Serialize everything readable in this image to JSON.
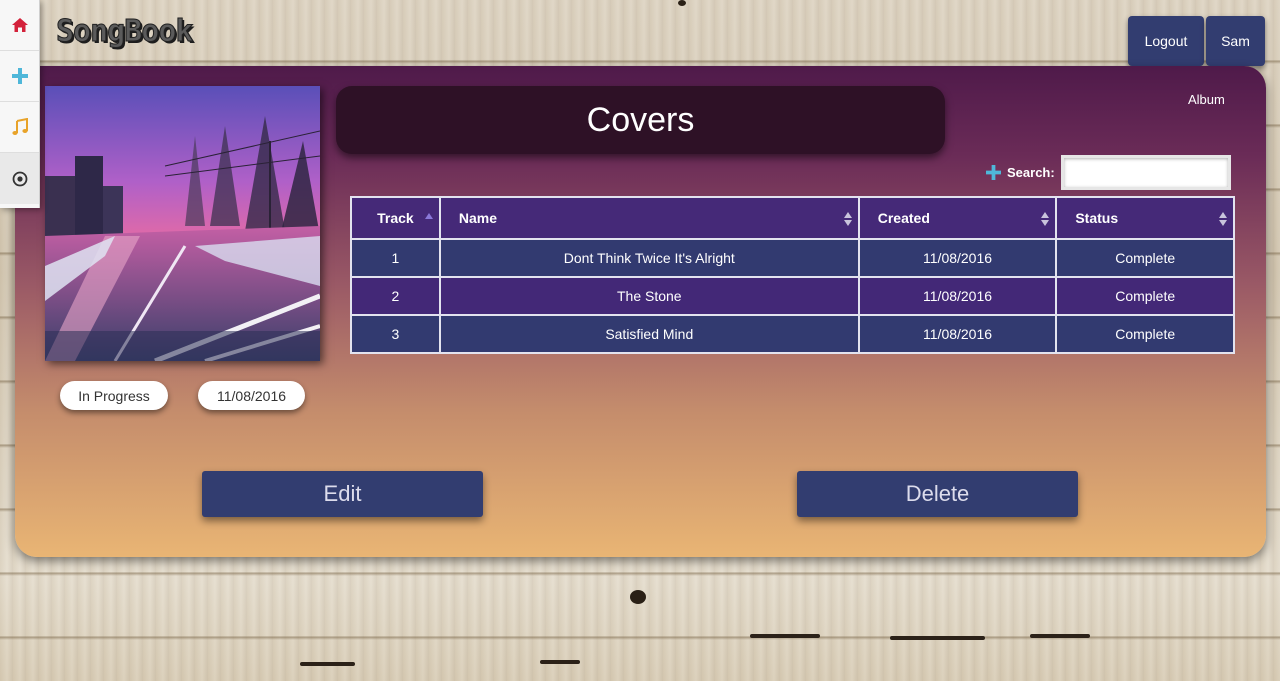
{
  "app": {
    "logo_text": "SongBook"
  },
  "sidenav": {
    "items": [
      {
        "icon": "home-icon",
        "color": "#d3213a"
      },
      {
        "icon": "plus-icon",
        "color": "#4fb7d9"
      },
      {
        "icon": "music-note-icon",
        "color": "#e8a32a"
      },
      {
        "icon": "record-icon",
        "color": "#333333"
      }
    ]
  },
  "header": {
    "logout_label": "Logout",
    "user_label": "Sam"
  },
  "album": {
    "title": "Covers",
    "type_label": "Album",
    "status": "In Progress",
    "date": "11/08/2016"
  },
  "search": {
    "label": "Search:",
    "value": ""
  },
  "table": {
    "columns": [
      "Track",
      "Name",
      "Created",
      "Status"
    ],
    "sorted_column": "Track",
    "rows": [
      {
        "track": "1",
        "name": "Dont Think Twice It's Alright",
        "created": "11/08/2016",
        "status": "Complete"
      },
      {
        "track": "2",
        "name": "The Stone",
        "created": "11/08/2016",
        "status": "Complete"
      },
      {
        "track": "3",
        "name": "Satisfied Mind",
        "created": "11/08/2016",
        "status": "Complete"
      }
    ]
  },
  "actions": {
    "edit_label": "Edit",
    "delete_label": "Delete"
  },
  "colors": {
    "primary_button": "#323d70",
    "header_purple": "#452978",
    "row_blue": "#323a70",
    "row_purple": "#432877"
  }
}
